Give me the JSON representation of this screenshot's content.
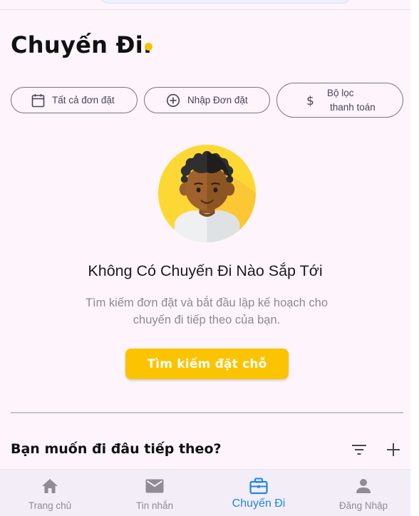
{
  "page": {
    "title": "Chuyến Đi.",
    "accent_color": "#fbc300",
    "background_color": "#fdf5fb"
  },
  "chips": {
    "all_bookings": {
      "label": "Tất cả đơn đặt",
      "icon": "calendar-icon"
    },
    "import_booking": {
      "label": "Nhập Đơn đặt",
      "icon": "add-circle-icon"
    },
    "payment_filter": {
      "label_line1": "Bộ lọc",
      "label_line2": "thanh toán",
      "icon": "dollar-icon"
    }
  },
  "empty_state": {
    "illustration": "traveler-avatar",
    "title": "Không Có Chuyến Đi Nào Sắp Tới",
    "description": "Tìm kiếm đơn đặt và bắt đầu lập kế hoạch cho chuyến đi tiếp theo của bạn.",
    "button_label": "Tìm kiếm đặt chỗ"
  },
  "next_section": {
    "title": "Bạn muốn đi đâu tiếp theo?",
    "icons": [
      "filter-icon",
      "add-icon"
    ]
  },
  "bottom_nav": {
    "active_color": "#1e88e5",
    "items": [
      {
        "label": "Trang chủ",
        "icon": "home-icon"
      },
      {
        "label": "Tin nhắn",
        "icon": "mail-icon"
      },
      {
        "label": "Chuyến Đi",
        "icon": "briefcase-icon",
        "active": true
      },
      {
        "label": "Đăng Nhập",
        "icon": "person-icon"
      }
    ]
  }
}
